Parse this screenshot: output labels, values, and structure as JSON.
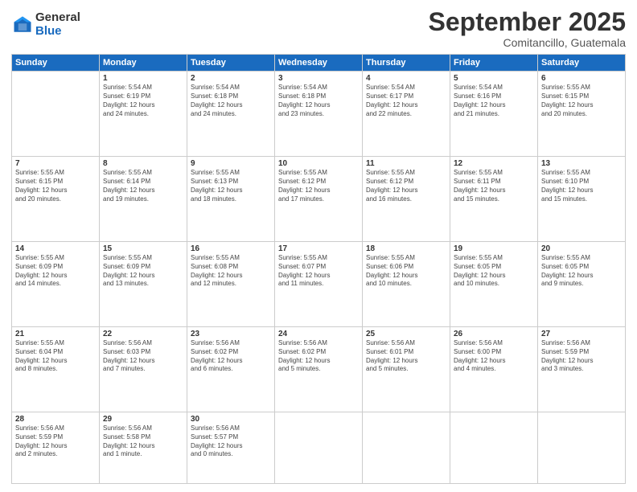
{
  "logo": {
    "general": "General",
    "blue": "Blue"
  },
  "header": {
    "month_year": "September 2025",
    "location": "Comitancillo, Guatemala"
  },
  "weekdays": [
    "Sunday",
    "Monday",
    "Tuesday",
    "Wednesday",
    "Thursday",
    "Friday",
    "Saturday"
  ],
  "weeks": [
    [
      {
        "day": "",
        "info": ""
      },
      {
        "day": "1",
        "info": "Sunrise: 5:54 AM\nSunset: 6:19 PM\nDaylight: 12 hours\nand 24 minutes."
      },
      {
        "day": "2",
        "info": "Sunrise: 5:54 AM\nSunset: 6:18 PM\nDaylight: 12 hours\nand 24 minutes."
      },
      {
        "day": "3",
        "info": "Sunrise: 5:54 AM\nSunset: 6:18 PM\nDaylight: 12 hours\nand 23 minutes."
      },
      {
        "day": "4",
        "info": "Sunrise: 5:54 AM\nSunset: 6:17 PM\nDaylight: 12 hours\nand 22 minutes."
      },
      {
        "day": "5",
        "info": "Sunrise: 5:54 AM\nSunset: 6:16 PM\nDaylight: 12 hours\nand 21 minutes."
      },
      {
        "day": "6",
        "info": "Sunrise: 5:55 AM\nSunset: 6:15 PM\nDaylight: 12 hours\nand 20 minutes."
      }
    ],
    [
      {
        "day": "7",
        "info": "Sunrise: 5:55 AM\nSunset: 6:15 PM\nDaylight: 12 hours\nand 20 minutes."
      },
      {
        "day": "8",
        "info": "Sunrise: 5:55 AM\nSunset: 6:14 PM\nDaylight: 12 hours\nand 19 minutes."
      },
      {
        "day": "9",
        "info": "Sunrise: 5:55 AM\nSunset: 6:13 PM\nDaylight: 12 hours\nand 18 minutes."
      },
      {
        "day": "10",
        "info": "Sunrise: 5:55 AM\nSunset: 6:12 PM\nDaylight: 12 hours\nand 17 minutes."
      },
      {
        "day": "11",
        "info": "Sunrise: 5:55 AM\nSunset: 6:12 PM\nDaylight: 12 hours\nand 16 minutes."
      },
      {
        "day": "12",
        "info": "Sunrise: 5:55 AM\nSunset: 6:11 PM\nDaylight: 12 hours\nand 15 minutes."
      },
      {
        "day": "13",
        "info": "Sunrise: 5:55 AM\nSunset: 6:10 PM\nDaylight: 12 hours\nand 15 minutes."
      }
    ],
    [
      {
        "day": "14",
        "info": "Sunrise: 5:55 AM\nSunset: 6:09 PM\nDaylight: 12 hours\nand 14 minutes."
      },
      {
        "day": "15",
        "info": "Sunrise: 5:55 AM\nSunset: 6:09 PM\nDaylight: 12 hours\nand 13 minutes."
      },
      {
        "day": "16",
        "info": "Sunrise: 5:55 AM\nSunset: 6:08 PM\nDaylight: 12 hours\nand 12 minutes."
      },
      {
        "day": "17",
        "info": "Sunrise: 5:55 AM\nSunset: 6:07 PM\nDaylight: 12 hours\nand 11 minutes."
      },
      {
        "day": "18",
        "info": "Sunrise: 5:55 AM\nSunset: 6:06 PM\nDaylight: 12 hours\nand 10 minutes."
      },
      {
        "day": "19",
        "info": "Sunrise: 5:55 AM\nSunset: 6:05 PM\nDaylight: 12 hours\nand 10 minutes."
      },
      {
        "day": "20",
        "info": "Sunrise: 5:55 AM\nSunset: 6:05 PM\nDaylight: 12 hours\nand 9 minutes."
      }
    ],
    [
      {
        "day": "21",
        "info": "Sunrise: 5:55 AM\nSunset: 6:04 PM\nDaylight: 12 hours\nand 8 minutes."
      },
      {
        "day": "22",
        "info": "Sunrise: 5:56 AM\nSunset: 6:03 PM\nDaylight: 12 hours\nand 7 minutes."
      },
      {
        "day": "23",
        "info": "Sunrise: 5:56 AM\nSunset: 6:02 PM\nDaylight: 12 hours\nand 6 minutes."
      },
      {
        "day": "24",
        "info": "Sunrise: 5:56 AM\nSunset: 6:02 PM\nDaylight: 12 hours\nand 5 minutes."
      },
      {
        "day": "25",
        "info": "Sunrise: 5:56 AM\nSunset: 6:01 PM\nDaylight: 12 hours\nand 5 minutes."
      },
      {
        "day": "26",
        "info": "Sunrise: 5:56 AM\nSunset: 6:00 PM\nDaylight: 12 hours\nand 4 minutes."
      },
      {
        "day": "27",
        "info": "Sunrise: 5:56 AM\nSunset: 5:59 PM\nDaylight: 12 hours\nand 3 minutes."
      }
    ],
    [
      {
        "day": "28",
        "info": "Sunrise: 5:56 AM\nSunset: 5:59 PM\nDaylight: 12 hours\nand 2 minutes."
      },
      {
        "day": "29",
        "info": "Sunrise: 5:56 AM\nSunset: 5:58 PM\nDaylight: 12 hours\nand 1 minute."
      },
      {
        "day": "30",
        "info": "Sunrise: 5:56 AM\nSunset: 5:57 PM\nDaylight: 12 hours\nand 0 minutes."
      },
      {
        "day": "",
        "info": ""
      },
      {
        "day": "",
        "info": ""
      },
      {
        "day": "",
        "info": ""
      },
      {
        "day": "",
        "info": ""
      }
    ]
  ]
}
